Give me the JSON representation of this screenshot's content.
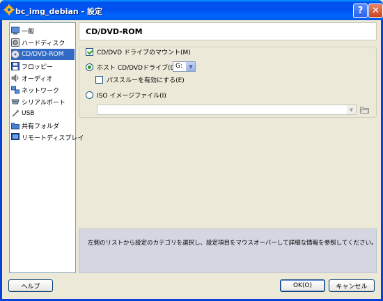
{
  "window": {
    "title": "bc_img_debian - 設定",
    "help_button": "?",
    "close_button": "✕"
  },
  "sidebar": {
    "items": [
      {
        "label": "一般",
        "icon": "general-icon",
        "selected": false
      },
      {
        "label": "ハードディスク",
        "icon": "hard-disk-icon",
        "selected": false
      },
      {
        "label": "CD/DVD-ROM",
        "icon": "cd-dvd-icon",
        "selected": true
      },
      {
        "label": "フロッピー",
        "icon": "floppy-icon",
        "selected": false
      },
      {
        "label": "オーディオ",
        "icon": "audio-icon",
        "selected": false
      },
      {
        "label": "ネットワーク",
        "icon": "network-icon",
        "selected": false
      },
      {
        "label": "シリアルポート",
        "icon": "serial-port-icon",
        "selected": false
      },
      {
        "label": "USB",
        "icon": "usb-icon",
        "selected": false
      },
      {
        "label": "共有フォルダ",
        "icon": "shared-folder-icon",
        "selected": false
      },
      {
        "label": "リモートディスプレイ",
        "icon": "remote-display-icon",
        "selected": false
      }
    ]
  },
  "page": {
    "title": "CD/DVD-ROM",
    "mount_label": "CD/DVD ドライブのマウント(M)",
    "mount_checked": true,
    "host_drive_label": "ホスト CD/DVDドライブ(D)",
    "host_drive_selected": true,
    "host_drive_value": "G:",
    "passthrough_label": "パススルーを有効にする(E)",
    "passthrough_checked": false,
    "iso_label": "ISO イメージファイル(I)",
    "iso_selected": false,
    "iso_value": ""
  },
  "info": {
    "text": "左側のリストから設定のカテゴリを選択し、設定項目をマウスオーバーして詳細な情報を参照してください。"
  },
  "buttons": {
    "help": "ヘルプ",
    "ok": "OK(O)",
    "cancel": "キャンセル"
  },
  "colors": {
    "selection": "#316ac5",
    "titlebar": "#0054e3",
    "check": "#21a121"
  }
}
